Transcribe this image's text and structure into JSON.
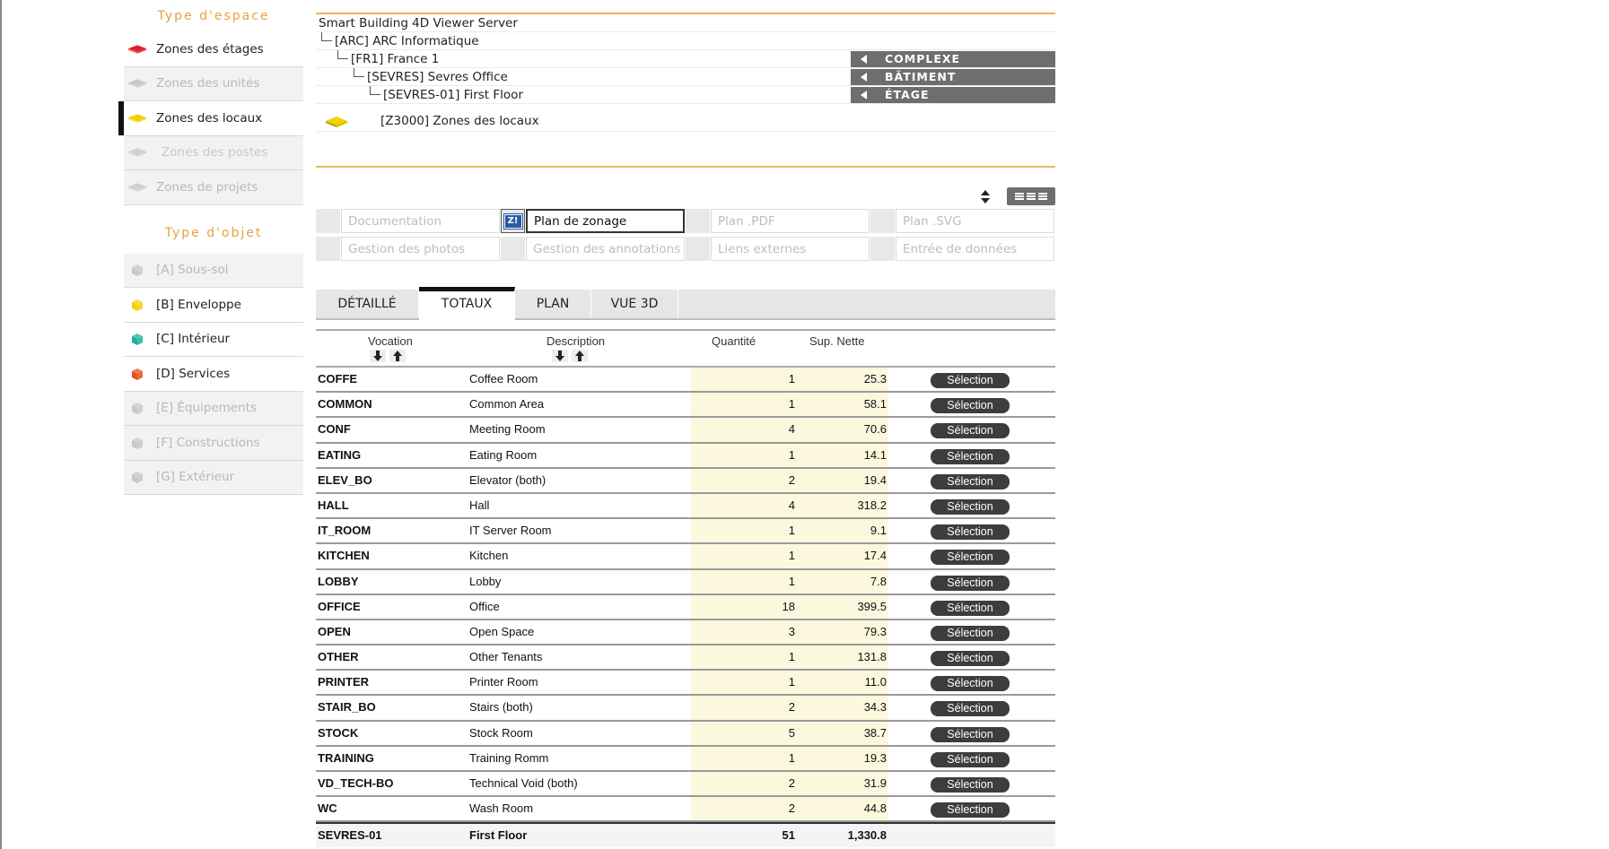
{
  "sidebar": {
    "space_type_title": "Type d'espace",
    "space_items": [
      {
        "label": "Zones des étages",
        "color": "#e41e26",
        "state": "active"
      },
      {
        "label": "Zones des unités",
        "color": "#c8c8c8",
        "state": "inactive"
      },
      {
        "label": "Zones des locaux",
        "color": "#f2d100",
        "state": "selected"
      },
      {
        "label": "Zones des postes",
        "color": "#d0d0d0",
        "state": "dim"
      },
      {
        "label": "Zones de projets",
        "color": "#d0d0d0",
        "state": "inactive"
      }
    ],
    "object_type_title": "Type d'objet",
    "object_items": [
      {
        "label": "[A] Sous-sol",
        "color": "#c8c8c8",
        "state": "inactive"
      },
      {
        "label": "[B] Enveloppe",
        "color": "#f2d100",
        "state": "active"
      },
      {
        "label": "[C] Intérieur",
        "color": "#17b39a",
        "state": "active"
      },
      {
        "label": "[D] Services",
        "color": "#e4501e",
        "state": "active"
      },
      {
        "label": "[E] Équipements",
        "color": "#c8c8c8",
        "state": "inactive"
      },
      {
        "label": "[F] Constructions",
        "color": "#c8c8c8",
        "state": "inactive"
      },
      {
        "label": "[G] Extérieur",
        "color": "#c8c8c8",
        "state": "inactive"
      }
    ]
  },
  "tree": {
    "root": "Smart Building 4D Viewer Server",
    "level1": "[ARC] ARC Informatique",
    "level2": "[FR1] France 1",
    "level3": "[SEVRES] Sevres Office",
    "level4": "[SEVRES-01] First Floor",
    "zone": "[Z3000] Zones des locaux",
    "nav_complexe": "COMPLEXE",
    "nav_batiment": "BÂTIMENT",
    "nav_etage": "ÉTAGE"
  },
  "docs": [
    {
      "label": "Documentation",
      "active": false,
      "badge": ""
    },
    {
      "label": "Plan de zonage",
      "active": true,
      "badge": "Z!"
    },
    {
      "label": "Plan .PDF",
      "active": false,
      "badge": ""
    },
    {
      "label": "Plan .SVG",
      "active": false,
      "badge": ""
    },
    {
      "label": "Gestion des photos",
      "active": false,
      "badge": ""
    },
    {
      "label": "Gestion des annotations",
      "active": false,
      "badge": ""
    },
    {
      "label": "Liens externes",
      "active": false,
      "badge": ""
    },
    {
      "label": "Entrée de données",
      "active": false,
      "badge": ""
    }
  ],
  "tabs": [
    {
      "label": "DÉTAILLÉ",
      "active": false
    },
    {
      "label": "TOTAUX",
      "active": true
    },
    {
      "label": "PLAN",
      "active": false
    },
    {
      "label": "VUE 3D",
      "active": false
    }
  ],
  "table": {
    "headers": {
      "vocation": "Vocation",
      "description": "Description",
      "quantite": "Quantité",
      "sup": "Sup. Nette"
    },
    "select_label": "Sélection",
    "rows": [
      {
        "code": "COFFE",
        "desc": "Coffee Room",
        "qty": "1",
        "sup": "25.3"
      },
      {
        "code": "COMMON",
        "desc": "Common Area",
        "qty": "1",
        "sup": "58.1"
      },
      {
        "code": "CONF",
        "desc": "Meeting Room",
        "qty": "4",
        "sup": "70.6"
      },
      {
        "code": "EATING",
        "desc": "Eating Room",
        "qty": "1",
        "sup": "14.1"
      },
      {
        "code": "ELEV_BO",
        "desc": "Elevator (both)",
        "qty": "2",
        "sup": "19.4"
      },
      {
        "code": "HALL",
        "desc": "Hall",
        "qty": "4",
        "sup": "318.2"
      },
      {
        "code": "IT_ROOM",
        "desc": "IT Server Room",
        "qty": "1",
        "sup": "9.1"
      },
      {
        "code": "KITCHEN",
        "desc": "Kitchen",
        "qty": "1",
        "sup": "17.4"
      },
      {
        "code": "LOBBY",
        "desc": "Lobby",
        "qty": "1",
        "sup": "7.8"
      },
      {
        "code": "OFFICE",
        "desc": "Office",
        "qty": "18",
        "sup": "399.5"
      },
      {
        "code": "OPEN",
        "desc": "Open Space",
        "qty": "3",
        "sup": "79.3"
      },
      {
        "code": "OTHER",
        "desc": "Other Tenants",
        "qty": "1",
        "sup": "131.8"
      },
      {
        "code": "PRINTER",
        "desc": "Printer Room",
        "qty": "1",
        "sup": "11.0"
      },
      {
        "code": "STAIR_BO",
        "desc": "Stairs (both)",
        "qty": "2",
        "sup": "34.3"
      },
      {
        "code": "STOCK",
        "desc": "Stock Room",
        "qty": "5",
        "sup": "38.7"
      },
      {
        "code": "TRAINING",
        "desc": "Training Romm",
        "qty": "1",
        "sup": "19.3"
      },
      {
        "code": "VD_TECH-BO",
        "desc": "Technical Void (both)",
        "qty": "2",
        "sup": "31.9"
      },
      {
        "code": "WC",
        "desc": "Wash Room",
        "qty": "2",
        "sup": "44.8"
      }
    ],
    "total": {
      "code": "SEVRES-01",
      "desc": "First Floor",
      "qty": "51",
      "sup": "1,330.8"
    }
  },
  "icons": {
    "flat_zone": "zone-slab-icon",
    "cube": "cube-icon",
    "sort_up": "arrow-up-icon",
    "sort_down": "arrow-down-icon",
    "view": "list-view-icon"
  }
}
